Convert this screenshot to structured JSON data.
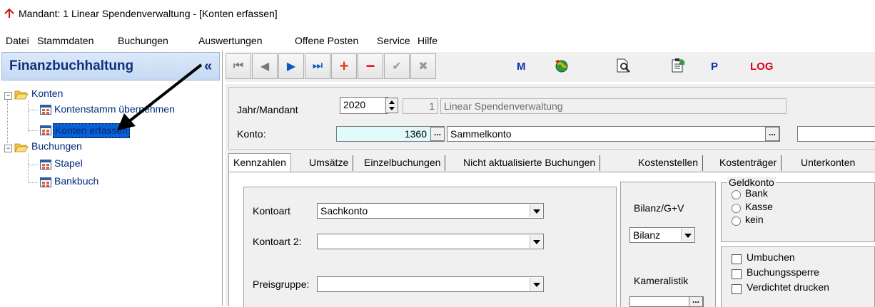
{
  "window": {
    "title": "Mandant: 1 Linear Spendenverwaltung - [Konten erfassen]"
  },
  "menu": [
    "Datei",
    "Stammdaten",
    "Buchungen",
    "Auswertungen",
    "Offene Posten",
    "Service",
    "Hilfe"
  ],
  "sidebar": {
    "header": "Finanzbuchhaltung",
    "collapse_glyph": "«",
    "tree": [
      {
        "label": "Konten",
        "children": [
          "Kontenstamm übernehmen",
          "Konten erfassen"
        ]
      },
      {
        "label": "Buchungen",
        "children": [
          "Stapel",
          "Bankbuch"
        ]
      }
    ],
    "selected": "Konten erfassen"
  },
  "toolbar": {
    "first": "⏮",
    "prev": "◀",
    "next": "▶",
    "last": "⏭",
    "add": "+",
    "remove": "−",
    "confirm": "✔",
    "cancel": "✖",
    "m_label": "M",
    "p_label": "P",
    "log_label": "LOG"
  },
  "form": {
    "jahr_label": "Jahr/Mandant",
    "jahr_value": "2020",
    "mandant_value": "1",
    "mandant_name": "Linear Spendenverwaltung",
    "konto_label": "Konto:",
    "konto_value": "1360",
    "konto_name": "Sammelkonto",
    "lookup_btn": "...",
    "tabs": [
      "Kennzahlen",
      "Umsätze",
      "Einzelbuchungen",
      "Nicht aktualisierte Buchungen",
      "Kostenstellen",
      "Kostenträger",
      "Unterkonten"
    ],
    "active_tab": "Kennzahlen",
    "kontoart_label": "Kontoart",
    "kontoart_value": "Sachkonto",
    "kontoart2_label": "Kontoart 2:",
    "kontoart2_value": "",
    "preisgruppe_label": "Preisgruppe:",
    "preisgruppe_value": "",
    "bilanz_label": "Bilanz/G+V",
    "bilanz_value": "Bilanz",
    "kameralistik_label": "Kameralistik",
    "geldkonto_label": "Geldkonto",
    "geldkonto_options": [
      "Bank",
      "Kasse",
      "kein"
    ],
    "checkboxes": [
      "Umbuchen",
      "Buchungssperre",
      "Verdichtet drucken"
    ]
  },
  "colors": {
    "selection": "#0a61d4",
    "header_text": "#10307a",
    "log": "#e0001a",
    "blue_text": "#0a2fb0"
  }
}
